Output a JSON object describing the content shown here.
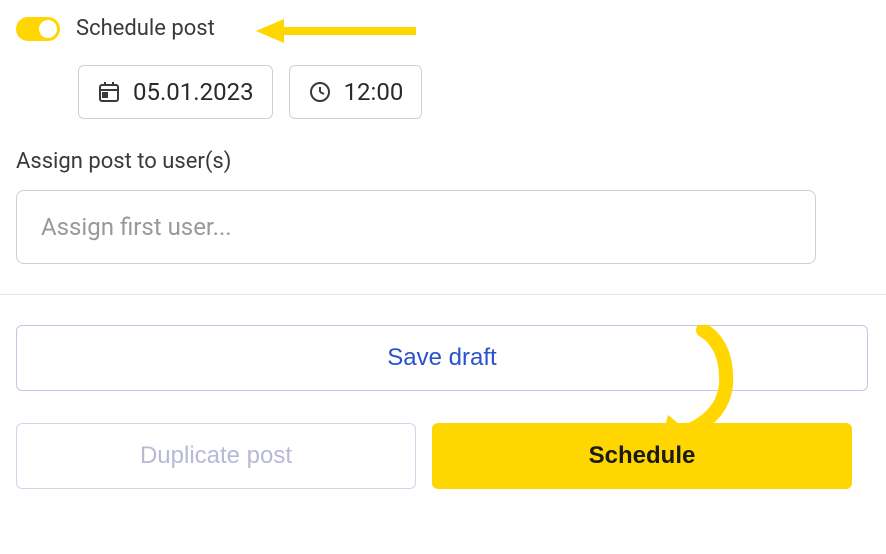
{
  "schedule": {
    "toggle_label": "Schedule post",
    "date": "05.01.2023",
    "time": "12:00"
  },
  "assign": {
    "label": "Assign post to user(s)",
    "placeholder": "Assign first user..."
  },
  "buttons": {
    "save_draft": "Save draft",
    "duplicate": "Duplicate post",
    "schedule": "Schedule"
  }
}
